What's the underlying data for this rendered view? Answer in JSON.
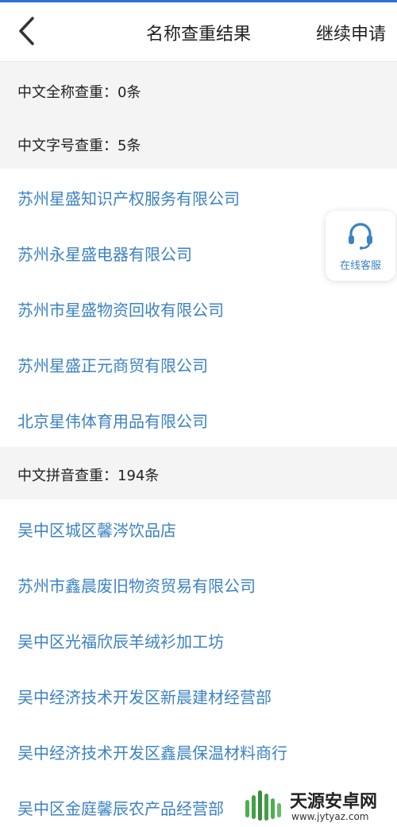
{
  "header": {
    "back_icon": "chevron-left-icon",
    "title": "名称查重结果",
    "continue_label": "继续申请"
  },
  "full_name_check": {
    "label": "中文全称查重：0条"
  },
  "trade_name_check": {
    "label": "中文字号查重：5条",
    "items": [
      "苏州星盛知识产权服务有限公司",
      "苏州永星盛电器有限公司",
      "苏州市星盛物资回收有限公司",
      "苏州星盛正元商贸有限公司",
      "北京星伟体育用品有限公司"
    ]
  },
  "pinyin_check": {
    "label": "中文拼音查重：194条",
    "items": [
      "吴中区城区馨涔饮品店",
      "苏州市鑫晨废旧物资贸易有限公司",
      "吴中区光福欣辰羊绒衫加工坊",
      "吴中经济技术开发区新晨建材经营部",
      "吴中经济技术开发区鑫晨保温材料商行",
      "吴中区金庭馨辰农产品经营部"
    ]
  },
  "customer_service": {
    "icon": "headset-icon",
    "label": "在线客服"
  },
  "watermark": {
    "title": "天源安卓网",
    "url": "www.jytyaz.com"
  },
  "colors": {
    "link": "#3b82c4",
    "section_bg": "#f4f4f4",
    "accent": "#2f6fd6"
  }
}
